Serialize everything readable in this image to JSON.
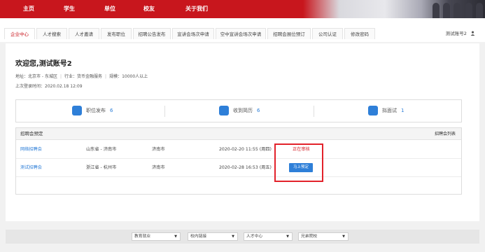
{
  "topnav": {
    "items": [
      "主页",
      "学生",
      "单位",
      "校友",
      "关于我们"
    ]
  },
  "subnav": {
    "tabs": [
      "企业中心",
      "人才搜索",
      "人才邀请",
      "发布职位",
      "招聘公告发布",
      "宣讲会场次申请",
      "空中宣讲会场次申请",
      "招聘会展位预订",
      "公司认证",
      "修改密码"
    ],
    "active_index": 0,
    "account": "测试账号2",
    "account_icon": "user-icon"
  },
  "welcome": {
    "title": "欢迎您,测试账号2",
    "address": "地址：北京市 - 东城区",
    "industry": "行业：货币金融服务",
    "scale": "规模：10000人以上",
    "last_login": "上次登录时间：2020.02.18 12:09"
  },
  "stats": [
    {
      "label": "职位发布",
      "value": "6",
      "icon": "briefcase-icon"
    },
    {
      "label": "收到简历",
      "value": "6",
      "icon": "resume-icon"
    },
    {
      "label": "拟面试",
      "value": "1",
      "icon": "interview-icon"
    }
  ],
  "fair": {
    "title": "招聘会预定",
    "list_link": "招聘会列表",
    "rows": [
      {
        "name": "网络招聘会",
        "region": "山东省 - 济南市",
        "city": "济南市",
        "time": "2020-02-20 11:55 (周四)",
        "status": "正在审核"
      },
      {
        "name": "测试招聘会",
        "region": "浙江省 - 杭州市",
        "city": "济南市",
        "time": "2020-02-28 16:53 (周五)",
        "action": "马上预定"
      }
    ]
  },
  "footer": {
    "selects": [
      "教育就业",
      "校内链接",
      "人才中心",
      "兄弟院校"
    ]
  },
  "colors": {
    "brand_red": "#c8161d",
    "link_blue": "#2e7fd8",
    "status_red": "#d4232b"
  }
}
